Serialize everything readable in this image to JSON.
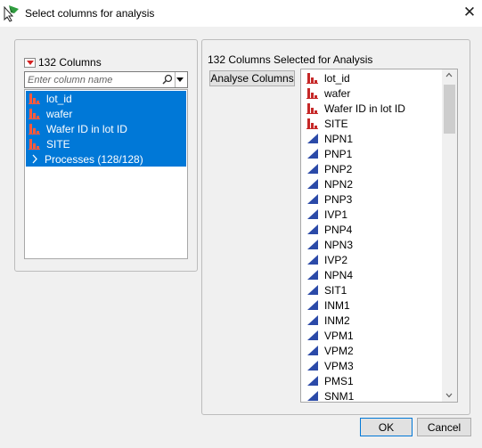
{
  "window": {
    "title": "Select columns for analysis"
  },
  "icons": {
    "app": "jmp-app-icon",
    "close": "close-icon",
    "search": "search-icon"
  },
  "left_panel": {
    "header": "132 Columns",
    "search_placeholder": "Enter column name",
    "items": [
      {
        "label": "lot_id",
        "icon": "nominal-icon",
        "selected": true
      },
      {
        "label": "wafer",
        "icon": "nominal-icon",
        "selected": true
      },
      {
        "label": "Wafer ID in lot ID",
        "icon": "nominal-icon",
        "selected": true
      },
      {
        "label": "SITE",
        "icon": "nominal-icon",
        "selected": true
      },
      {
        "label": "Processes (128/128)",
        "icon": "chevron-right-icon",
        "selected": true
      }
    ]
  },
  "right_panel": {
    "header": "132 Columns Selected for Analysis",
    "button_label": "Analyse Columns",
    "items": [
      {
        "label": "lot_id",
        "icon": "nominal-icon"
      },
      {
        "label": "wafer",
        "icon": "nominal-icon"
      },
      {
        "label": "Wafer ID in lot ID",
        "icon": "nominal-icon"
      },
      {
        "label": "SITE",
        "icon": "nominal-icon"
      },
      {
        "label": "NPN1",
        "icon": "continuous-icon"
      },
      {
        "label": "PNP1",
        "icon": "continuous-icon"
      },
      {
        "label": "PNP2",
        "icon": "continuous-icon"
      },
      {
        "label": "NPN2",
        "icon": "continuous-icon"
      },
      {
        "label": "PNP3",
        "icon": "continuous-icon"
      },
      {
        "label": "IVP1",
        "icon": "continuous-icon"
      },
      {
        "label": "PNP4",
        "icon": "continuous-icon"
      },
      {
        "label": "NPN3",
        "icon": "continuous-icon"
      },
      {
        "label": "IVP2",
        "icon": "continuous-icon"
      },
      {
        "label": "NPN4",
        "icon": "continuous-icon"
      },
      {
        "label": "SIT1",
        "icon": "continuous-icon"
      },
      {
        "label": "INM1",
        "icon": "continuous-icon"
      },
      {
        "label": "INM2",
        "icon": "continuous-icon"
      },
      {
        "label": "VPM1",
        "icon": "continuous-icon"
      },
      {
        "label": "VPM2",
        "icon": "continuous-icon"
      },
      {
        "label": "VPM3",
        "icon": "continuous-icon"
      },
      {
        "label": "PMS1",
        "icon": "continuous-icon"
      },
      {
        "label": "SNM1",
        "icon": "continuous-icon"
      }
    ]
  },
  "buttons": {
    "ok": "OK",
    "cancel": "Cancel"
  },
  "colors": {
    "selection": "#0078d7",
    "nominal": "#c62828",
    "continuous": "#2b4aa8"
  }
}
